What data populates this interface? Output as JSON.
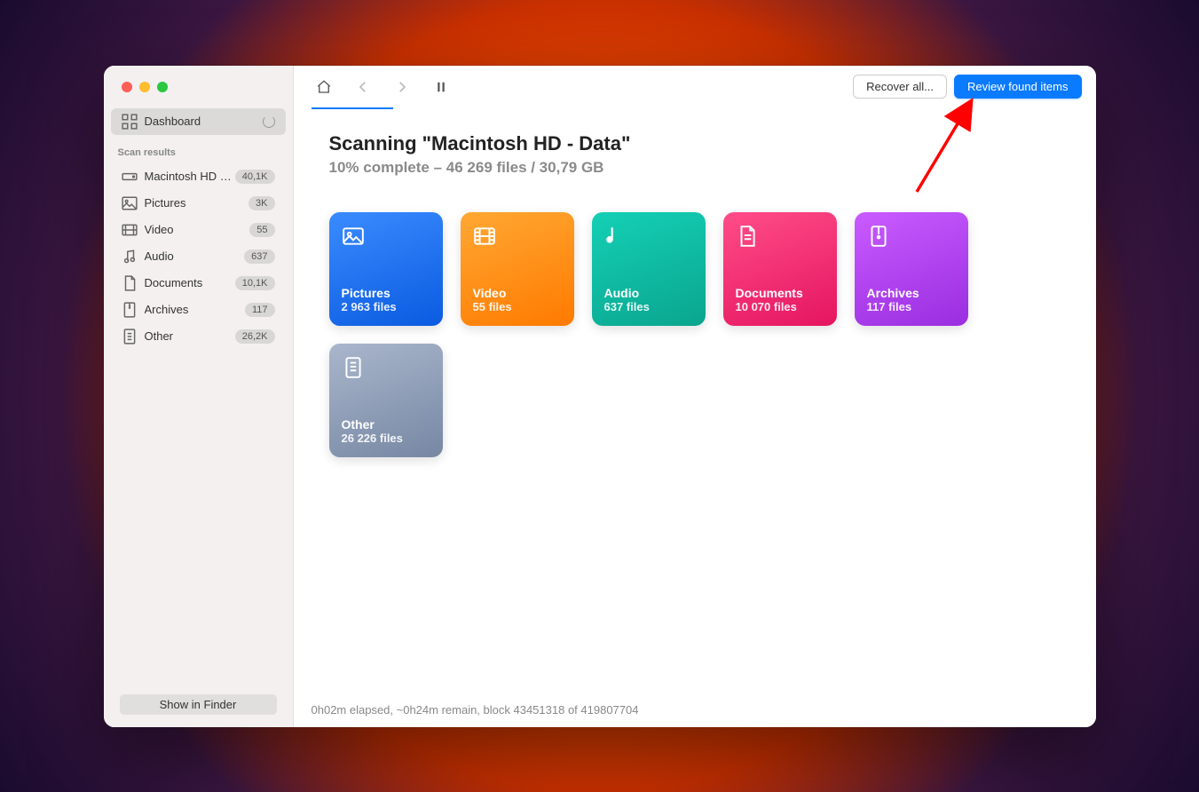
{
  "sidebar": {
    "dashboard_label": "Dashboard",
    "section_label": "Scan results",
    "items": [
      {
        "label": "Macintosh HD -…",
        "badge": "40,1K",
        "icon": "drive"
      },
      {
        "label": "Pictures",
        "badge": "3K",
        "icon": "picture"
      },
      {
        "label": "Video",
        "badge": "55",
        "icon": "video"
      },
      {
        "label": "Audio",
        "badge": "637",
        "icon": "audio"
      },
      {
        "label": "Documents",
        "badge": "10,1K",
        "icon": "document"
      },
      {
        "label": "Archives",
        "badge": "117",
        "icon": "archive"
      },
      {
        "label": "Other",
        "badge": "26,2K",
        "icon": "other"
      }
    ],
    "show_in_finder": "Show in Finder"
  },
  "toolbar": {
    "recover_all": "Recover all...",
    "review": "Review found items"
  },
  "scan": {
    "title": "Scanning \"Macintosh HD - Data\"",
    "subtitle": "10% complete – 46 269 files / 30,79 GB"
  },
  "cards": [
    {
      "type": "pictures",
      "title": "Pictures",
      "sub": "2 963 files"
    },
    {
      "type": "video",
      "title": "Video",
      "sub": "55 files"
    },
    {
      "type": "audio",
      "title": "Audio",
      "sub": "637 files"
    },
    {
      "type": "documents",
      "title": "Documents",
      "sub": "10 070 files"
    },
    {
      "type": "archives",
      "title": "Archives",
      "sub": "117 files"
    },
    {
      "type": "other",
      "title": "Other",
      "sub": "26 226 files"
    }
  ],
  "status": "0h02m elapsed, ~0h24m remain, block 43451318 of 419807704"
}
